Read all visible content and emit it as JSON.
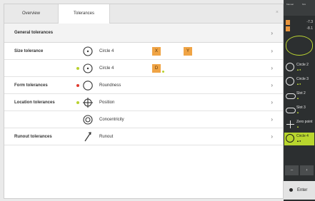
{
  "tabs": [
    {
      "label": "Overview"
    },
    {
      "label": "Tolerances"
    }
  ],
  "close_glyph": "×",
  "general": {
    "label": "General tolerances"
  },
  "rows": [
    {
      "category": "Size tolerance",
      "feature": "Circle 4",
      "icon": "circle-dot-icon",
      "badges": [
        "X",
        "Y"
      ],
      "dot": ""
    },
    {
      "category": "",
      "feature": "Circle 4",
      "icon": "circle-dot-icon",
      "badges": [
        "D"
      ],
      "dot": "#b8d12e"
    },
    {
      "category": "Form tolerances",
      "feature": "Roundness",
      "icon": "roundness-icon",
      "badges": [],
      "dot": "#e03a2e"
    },
    {
      "category": "Location tolerances",
      "feature": "Position",
      "icon": "position-icon",
      "badges": [],
      "dot": "#b8d12e"
    },
    {
      "category": "",
      "feature": "Concentricity",
      "icon": "concentricity-icon",
      "badges": [],
      "dot": ""
    },
    {
      "category": "Runout tolerances",
      "feature": "Runout",
      "icon": "runout-icon",
      "badges": [],
      "dot": ""
    }
  ],
  "chevron": "›",
  "sidebar": {
    "top_labels": [
      "Manual",
      "N/A"
    ],
    "values": [
      "-7.3",
      "-8.1"
    ],
    "features": [
      {
        "label": "Circle 2",
        "shape": "circle"
      },
      {
        "label": "Circle 3",
        "shape": "circle"
      },
      {
        "label": "Slot 2",
        "shape": "slot"
      },
      {
        "label": "Slot 3",
        "shape": "slot"
      },
      {
        "label": "Zero point",
        "shape": "zero"
      },
      {
        "label": "Circle 4",
        "shape": "circle",
        "selected": true
      }
    ],
    "nav": [
      "–",
      "‹"
    ],
    "enter_label": "Enter"
  },
  "colors": {
    "accent": "#b9d62e",
    "badge": "#f0a445",
    "error": "#e03a2e"
  }
}
